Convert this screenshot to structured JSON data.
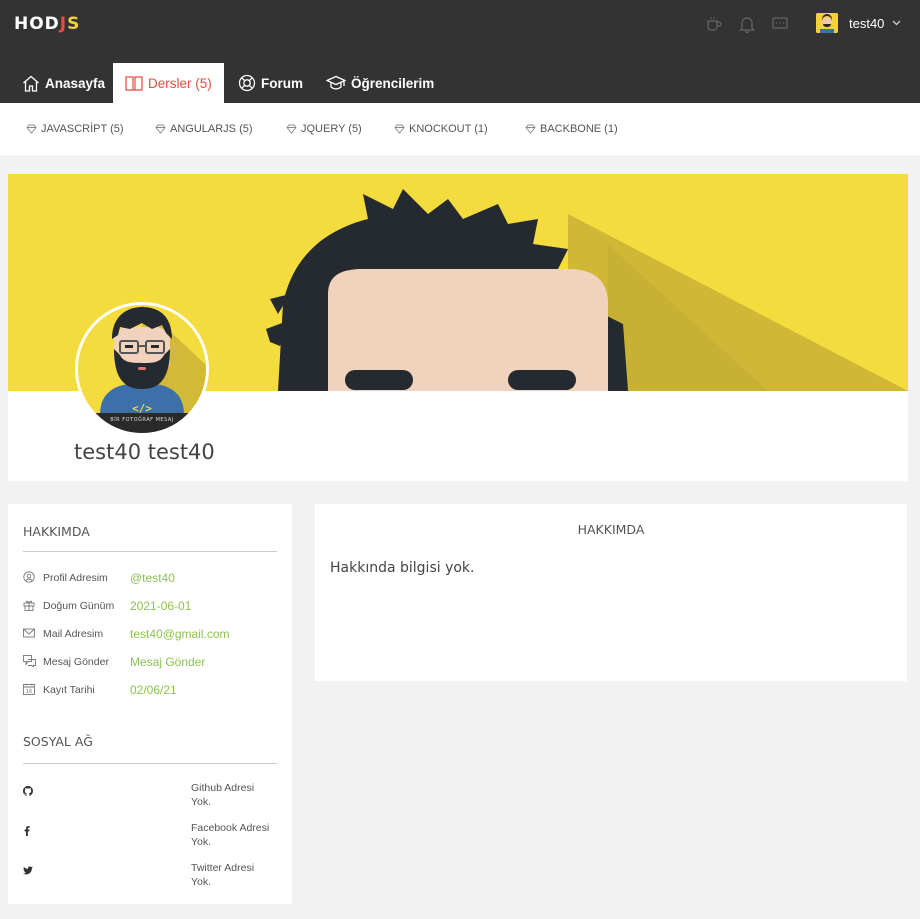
{
  "logo": {
    "w": "HOD",
    "r": "J",
    "y": "S"
  },
  "header": {
    "icons": [
      "coffee-icon",
      "bell-icon",
      "message-icon"
    ],
    "user": {
      "name": "test40"
    }
  },
  "nav": {
    "tabs": [
      {
        "label": "Anasayfa",
        "icon": "home-icon"
      },
      {
        "label": "Dersler (5)",
        "icon": "book-icon",
        "active": true
      },
      {
        "label": "Forum",
        "icon": "lifebuoy-icon"
      },
      {
        "label": "Öğrencilerim",
        "icon": "graduation-cap-icon"
      }
    ]
  },
  "subnav": {
    "items": [
      {
        "label": "JAVASCRİPT (5)"
      },
      {
        "label": "ANGULARJS (5)"
      },
      {
        "label": "JQUERY (5)"
      },
      {
        "label": "KNOCKOUT (1)"
      },
      {
        "label": "BACKBONE (1)"
      }
    ]
  },
  "profile": {
    "name": "test40 test40",
    "avatar_caption": "BİR FOTOĞRAF MESAJ",
    "cover_color": "#f4dc3f"
  },
  "about_side": {
    "title": "HAKKIMDA",
    "rows": [
      {
        "icon": "user-circle-icon",
        "label": "Profil Adresim",
        "value": "@test40"
      },
      {
        "icon": "gift-icon",
        "label": "Doğum Günüm",
        "value": "2021-06-01"
      },
      {
        "icon": "envelope-icon",
        "label": "Mail Adresim",
        "value": "test40@gmail.com"
      },
      {
        "icon": "chat-icon",
        "label": "Mesaj Gönder",
        "value": "Mesaj Gönder"
      },
      {
        "icon": "calendar-icon",
        "label": "Kayıt Tarihi",
        "value": "02/06/21"
      }
    ],
    "social_title": "SOSYAL AĞ",
    "social": [
      {
        "icon": "github-icon",
        "text": "Github Adresi Yok."
      },
      {
        "icon": "facebook-icon",
        "text": "Facebook Adresi Yok."
      },
      {
        "icon": "twitter-icon",
        "text": "Twitter Adresi Yok."
      }
    ]
  },
  "about_main": {
    "title": "HAKKIMDA",
    "text": "Hakkında bilgisi yok."
  },
  "colors": {
    "header_bg": "#333333",
    "accent_red": "#e74c3c",
    "link_green": "#8bc34a",
    "brand_yellow": "#f4dc3f"
  }
}
